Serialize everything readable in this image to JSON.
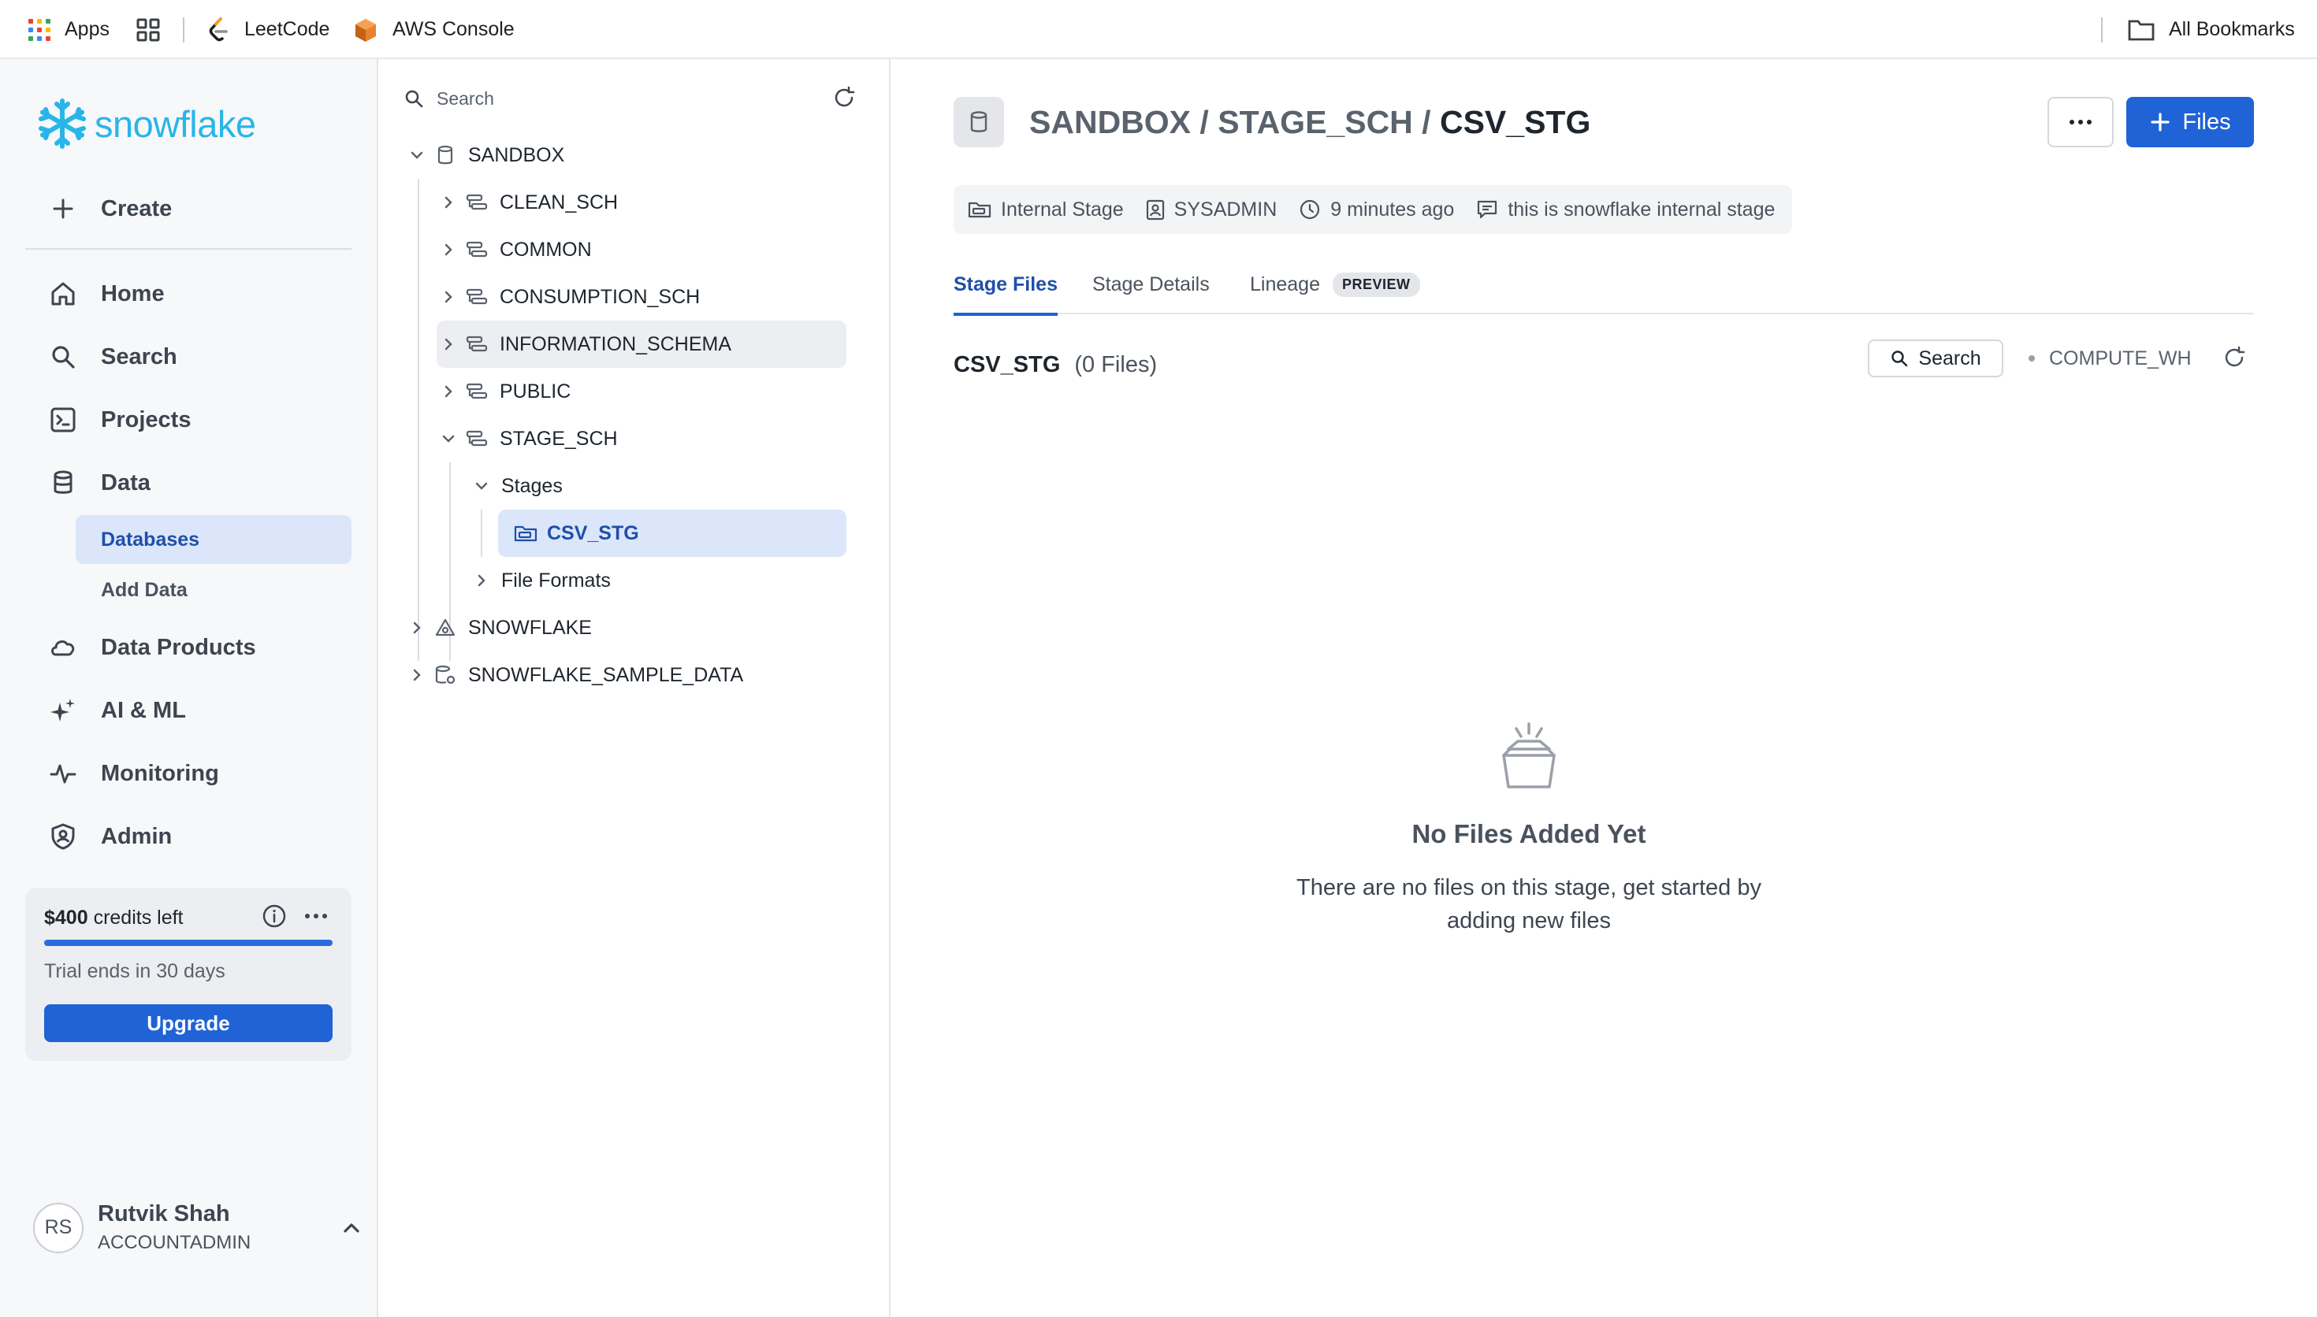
{
  "bookmarks": {
    "apps_label": "Apps",
    "leetcode_label": "LeetCode",
    "aws_label": "AWS Console",
    "all_bookmarks_label": "All Bookmarks"
  },
  "sidebar": {
    "logo_text": "snowflake",
    "create_label": "Create",
    "items": [
      {
        "label": "Home",
        "icon": "home-icon"
      },
      {
        "label": "Search",
        "icon": "search-icon"
      },
      {
        "label": "Projects",
        "icon": "terminal-icon"
      },
      {
        "label": "Data",
        "icon": "database-icon"
      },
      {
        "label": "Data Products",
        "icon": "cloud-icon"
      },
      {
        "label": "AI & ML",
        "icon": "sparkle-icon"
      },
      {
        "label": "Monitoring",
        "icon": "pulse-icon"
      },
      {
        "label": "Admin",
        "icon": "shield-user-icon"
      }
    ],
    "data_sub": {
      "databases": "Databases",
      "add_data": "Add Data"
    },
    "credits": {
      "amount": "$400",
      "suffix": " credits left",
      "trial": "Trial ends in 30 days",
      "upgrade_label": "Upgrade",
      "used_fraction": 1.0
    },
    "user": {
      "initials": "RS",
      "name": "Rutvik Shah",
      "role": "ACCOUNTADMIN"
    }
  },
  "tree": {
    "search_placeholder": "Search",
    "database": "SANDBOX",
    "schemas": [
      "CLEAN_SCH",
      "COMMON",
      "CONSUMPTION_SCH",
      "INFORMATION_SCHEMA",
      "PUBLIC",
      "STAGE_SCH"
    ],
    "stages_label": "Stages",
    "stage_item": "CSV_STG",
    "file_formats_label": "File Formats",
    "other_dbs": [
      "SNOWFLAKE",
      "SNOWFLAKE_SAMPLE_DATA"
    ]
  },
  "main": {
    "breadcrumb": {
      "db": "SANDBOX",
      "sep": " / ",
      "schema": "STAGE_SCH",
      "object": "CSV_STG"
    },
    "files_button": "Files",
    "meta": {
      "type": "Internal Stage",
      "owner": "SYSADMIN",
      "time": "9 minutes ago",
      "comment": "this is snowflake internal stage"
    },
    "tabs": {
      "stage_files": "Stage Files",
      "stage_details": "Stage Details",
      "lineage": "Lineage",
      "preview_badge": "PREVIEW"
    },
    "files_heading": {
      "name": "CSV_STG",
      "count": "(0 Files)"
    },
    "search_label": "Search",
    "warehouse": "COMPUTE_WH",
    "empty": {
      "title": "No Files Added Yet",
      "line1": "There are no files on this stage, get started by",
      "line2": "adding new files"
    }
  },
  "colors": {
    "brand": "#29b5e8",
    "accent": "#1f63d6",
    "selected_bg": "#dbe6fb"
  }
}
